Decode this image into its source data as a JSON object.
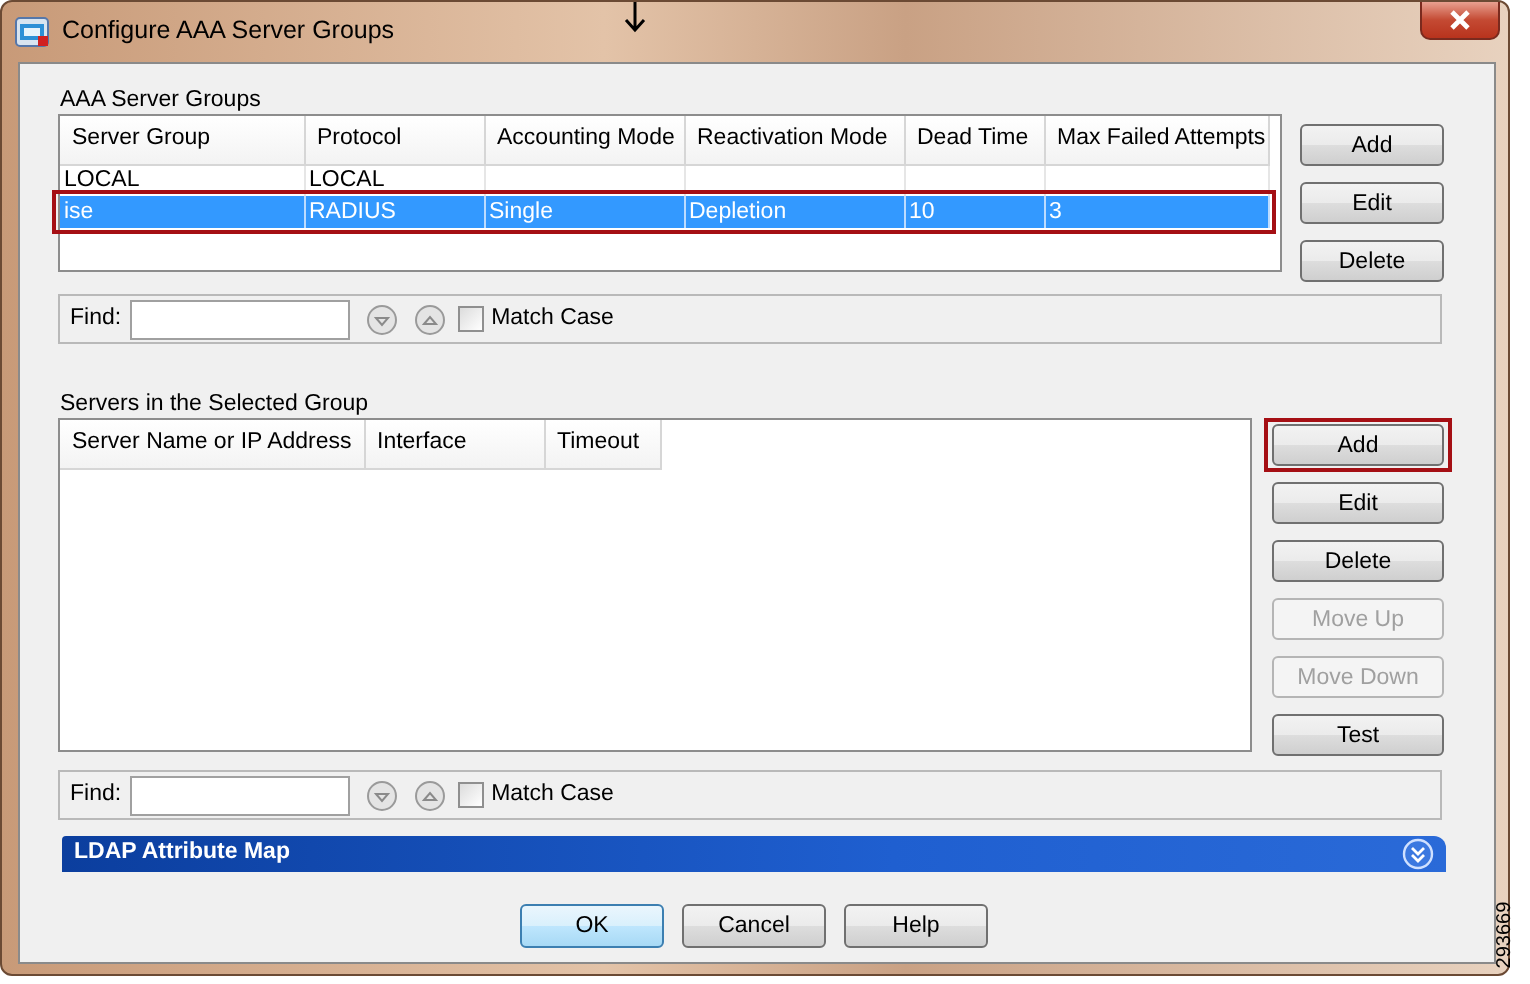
{
  "window": {
    "title": "Configure AAA Server Groups"
  },
  "server_groups": {
    "label": "AAA Server Groups",
    "columns": [
      "Server Group",
      "Protocol",
      "Accounting Mode",
      "Reactivation Mode",
      "Dead Time",
      "Max Failed Attempts"
    ],
    "rows": [
      {
        "cells": [
          "LOCAL",
          "LOCAL",
          "",
          "",
          "",
          ""
        ],
        "selected": false,
        "highlighted": false
      },
      {
        "cells": [
          "ise",
          "RADIUS",
          "Single",
          "Depletion",
          "10",
          "3"
        ],
        "selected": true,
        "highlighted": true
      }
    ],
    "buttons": [
      {
        "label": "Add",
        "disabled": false,
        "highlighted": false
      },
      {
        "label": "Edit",
        "disabled": false,
        "highlighted": false
      },
      {
        "label": "Delete",
        "disabled": false,
        "highlighted": false
      }
    ],
    "find": {
      "label": "Find:",
      "match_case": {
        "label": "Match Case",
        "checked": false
      }
    }
  },
  "servers": {
    "label": "Servers in the Selected Group",
    "columns": [
      "Server Name or IP Address",
      "Interface",
      "Timeout"
    ],
    "buttons": [
      {
        "label": "Add",
        "disabled": false,
        "highlighted": true
      },
      {
        "label": "Edit",
        "disabled": false,
        "highlighted": false
      },
      {
        "label": "Delete",
        "disabled": false,
        "highlighted": false
      },
      {
        "label": "Move Up",
        "disabled": true,
        "highlighted": false
      },
      {
        "label": "Move Down",
        "disabled": true,
        "highlighted": false
      },
      {
        "label": "Test",
        "disabled": false,
        "highlighted": false
      }
    ],
    "find": {
      "label": "Find:",
      "match_case": {
        "label": "Match Case",
        "checked": false
      }
    }
  },
  "ldap_section": {
    "title": "LDAP Attribute Map",
    "expanded": false
  },
  "dialog_buttons": [
    {
      "label": "OK",
      "default": true
    },
    {
      "label": "Cancel",
      "default": false
    },
    {
      "label": "Help",
      "default": false
    }
  ],
  "figure_number": "293669"
}
